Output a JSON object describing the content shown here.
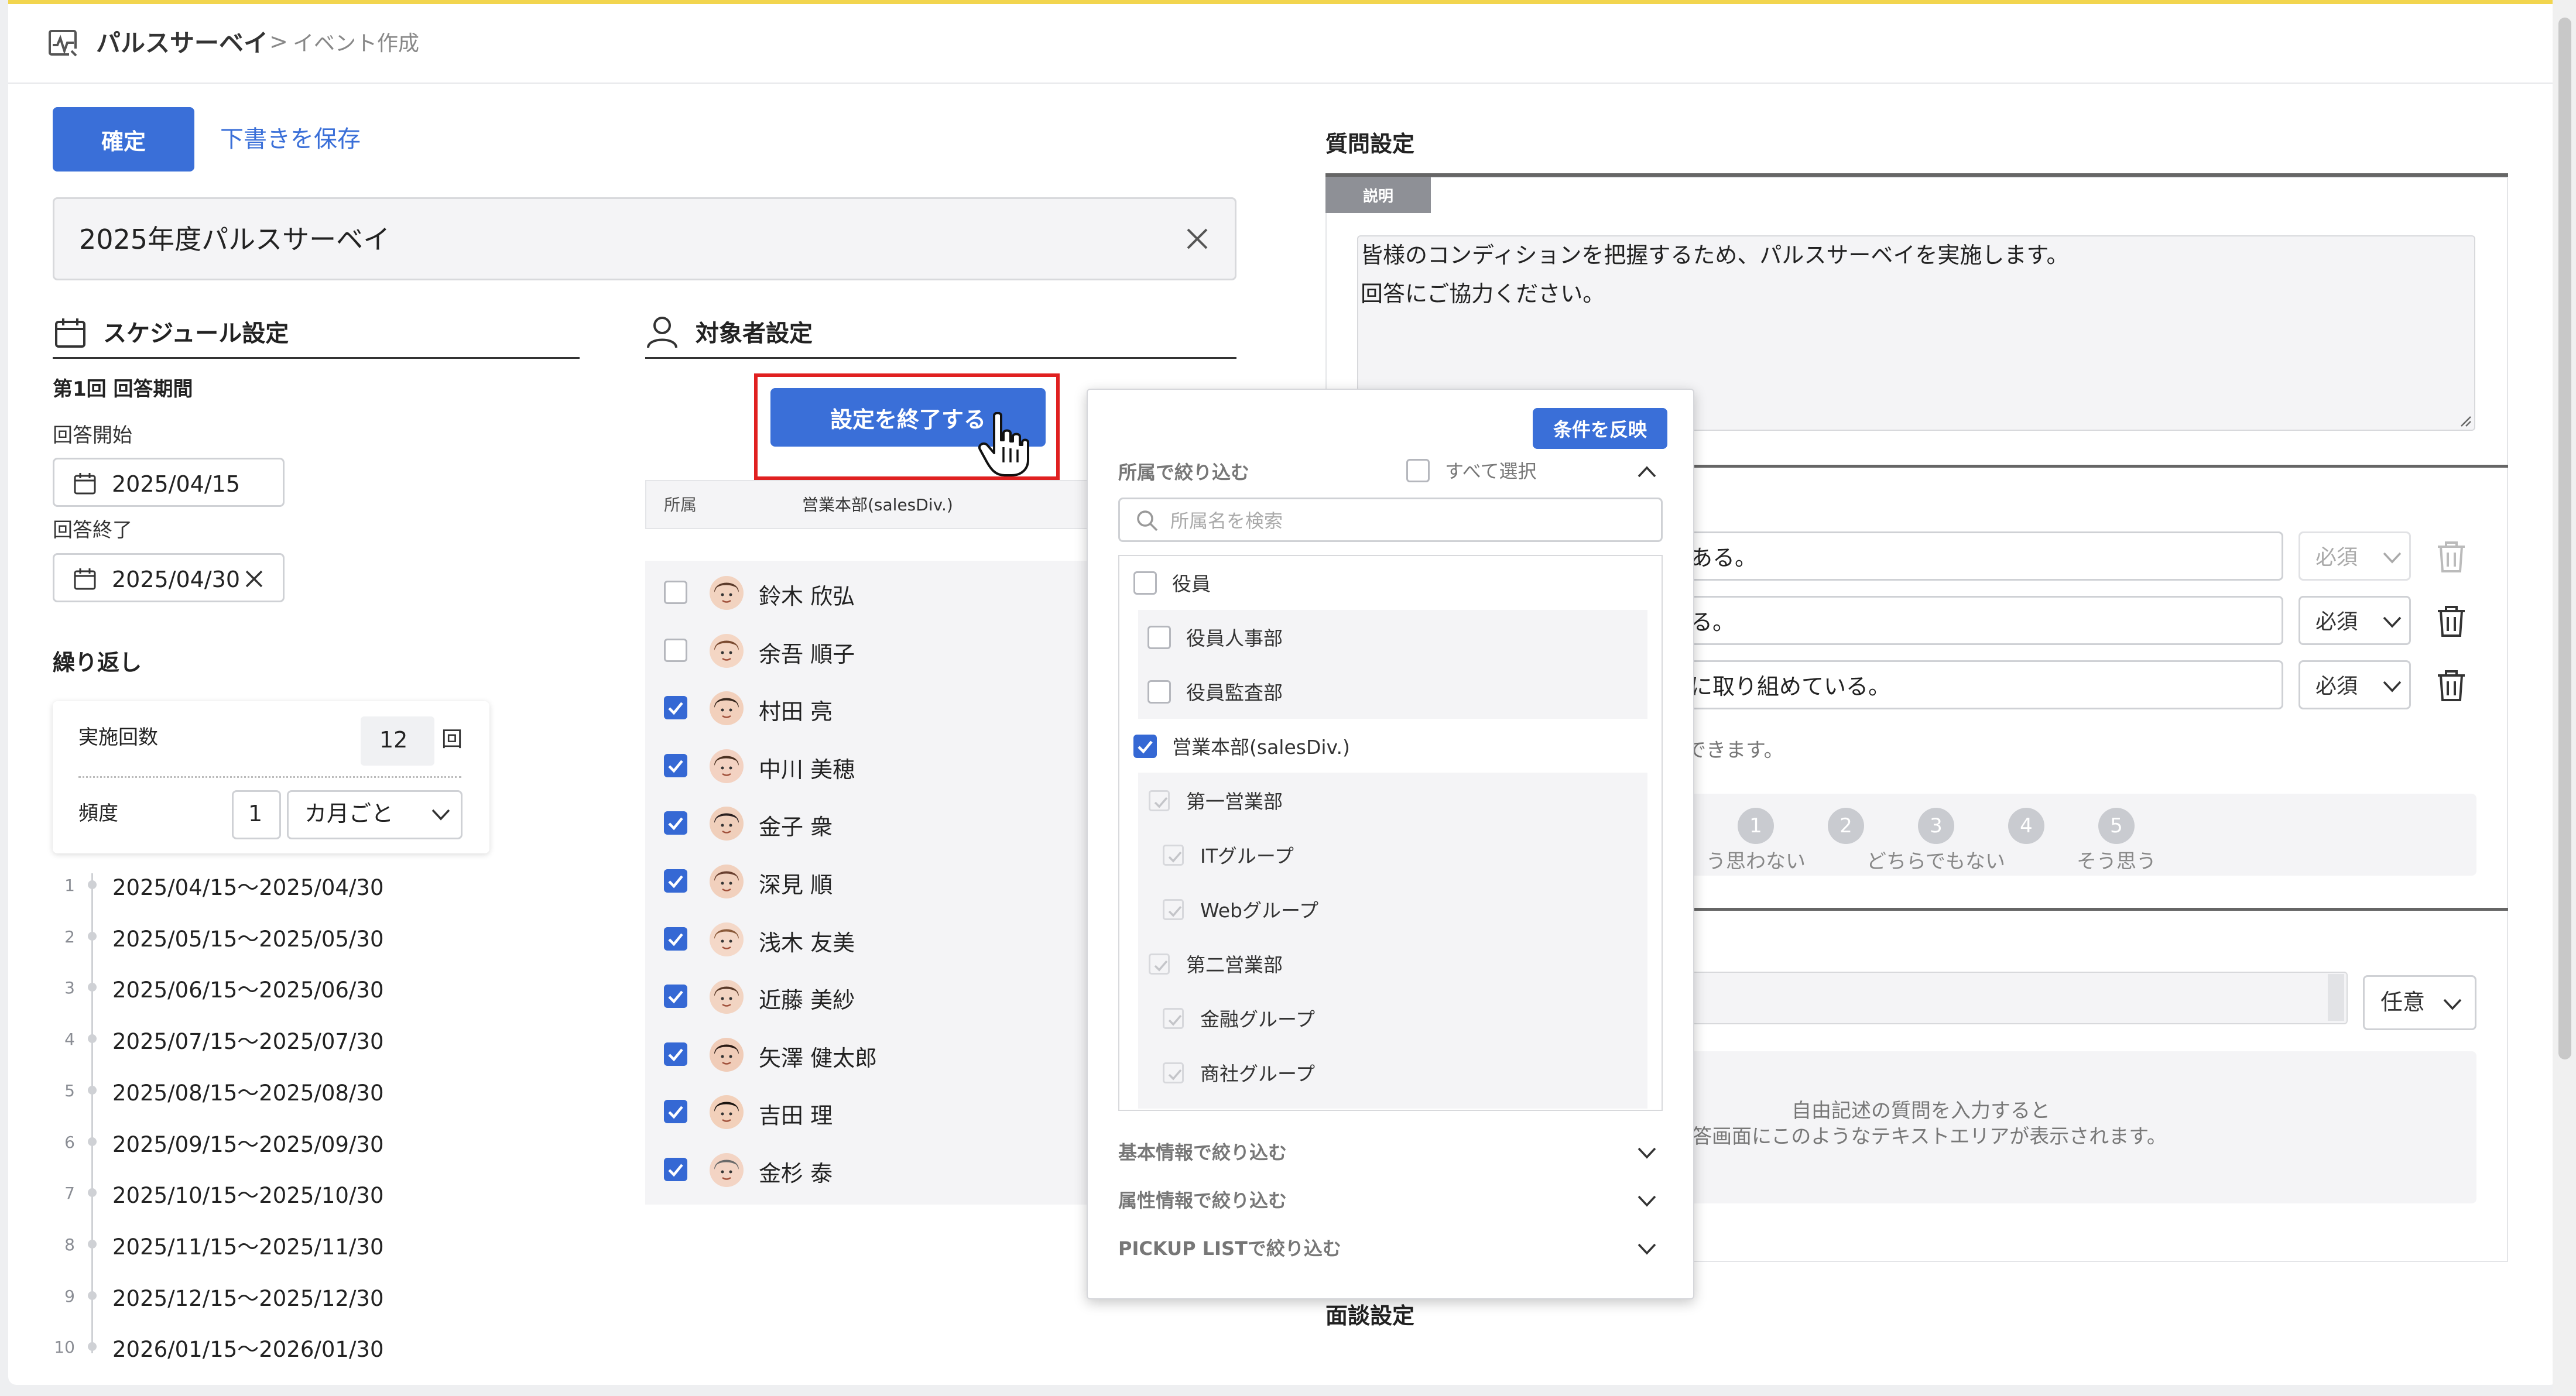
{
  "header": {
    "app_name": "パルスサーベイ",
    "breadcrumb_sep": ">",
    "breadcrumb_current": "イベント作成"
  },
  "toolbar": {
    "confirm_label": "確定",
    "save_draft_label": "下書きを保存"
  },
  "event_title": {
    "value": "2025年度パルスサーベイ"
  },
  "schedule": {
    "section_title": "スケジュール設定",
    "period_heading": "第1回 回答期間",
    "start_label": "回答開始",
    "start_value": "2025/04/15",
    "end_label": "回答終了",
    "end_value": "2025/04/30",
    "repeat_heading": "繰り返し",
    "count_label": "実施回数",
    "count_value": "12",
    "count_unit": "回",
    "frequency_label": "頻度",
    "frequency_value": "1",
    "frequency_unit": "カ月ごと",
    "rows": [
      {
        "n": "1",
        "range": "2025/04/15〜2025/04/30"
      },
      {
        "n": "2",
        "range": "2025/05/15〜2025/05/30"
      },
      {
        "n": "3",
        "range": "2025/06/15〜2025/06/30"
      },
      {
        "n": "4",
        "range": "2025/07/15〜2025/07/30"
      },
      {
        "n": "5",
        "range": "2025/08/15〜2025/08/30"
      },
      {
        "n": "6",
        "range": "2025/09/15〜2025/09/30"
      },
      {
        "n": "7",
        "range": "2025/10/15〜2025/10/30"
      },
      {
        "n": "8",
        "range": "2025/11/15〜2025/11/30"
      },
      {
        "n": "9",
        "range": "2025/12/15〜2025/12/30"
      },
      {
        "n": "10",
        "range": "2026/01/15〜2026/01/30"
      }
    ]
  },
  "target": {
    "section_title": "対象者設定",
    "finish_button": "設定を終了する",
    "col_dept": "所属",
    "col_dept_value": "営業本部(salesDiv.)",
    "people": [
      {
        "name": "鈴木 欣弘",
        "checked": false
      },
      {
        "name": "余吾 順子",
        "checked": false
      },
      {
        "name": "村田 亮",
        "checked": true
      },
      {
        "name": "中川 美穂",
        "checked": true
      },
      {
        "name": "金子 衆",
        "checked": true
      },
      {
        "name": "深見 順",
        "checked": true
      },
      {
        "name": "浅木 友美",
        "checked": true
      },
      {
        "name": "近藤 美紗",
        "checked": true
      },
      {
        "name": "矢澤 健太郎",
        "checked": true
      },
      {
        "name": "吉田 理",
        "checked": true
      },
      {
        "name": "金杉 泰",
        "checked": true
      }
    ]
  },
  "filter_panel": {
    "apply_button": "条件を反映",
    "dept_filter_label": "所属で絞り込む",
    "select_all_label": "すべて選択",
    "search_placeholder": "所属名を検索",
    "depts": [
      {
        "label": "役員",
        "level": 0,
        "state": "unchecked"
      },
      {
        "label": "役員人事部",
        "level": 1,
        "state": "unchecked"
      },
      {
        "label": "役員監査部",
        "level": 1,
        "state": "unchecked"
      },
      {
        "label": "営業本部(salesDiv.)",
        "level": 0,
        "state": "checked"
      },
      {
        "label": "第一営業部",
        "level": 1,
        "state": "disabled"
      },
      {
        "label": "ITグループ",
        "level": 2,
        "state": "disabled"
      },
      {
        "label": "Webグループ",
        "level": 2,
        "state": "disabled"
      },
      {
        "label": "第二営業部",
        "level": 1,
        "state": "disabled"
      },
      {
        "label": "金融グループ",
        "level": 2,
        "state": "disabled"
      },
      {
        "label": "商社グループ",
        "level": 2,
        "state": "disabled"
      }
    ],
    "basic_filter_label": "基本情報で絞り込む",
    "attr_filter_label": "属性情報で絞り込む",
    "pickup_filter_label": "PICKUP LISTで絞り込む"
  },
  "questions": {
    "section_title": "質問設定",
    "description_tab": "説明",
    "description_line1": "皆様のコンディションを把握するため、パルスサーベイを実施します。",
    "description_line2": "回答にご協力ください。",
    "items": [
      {
        "text_fragment": "ある。",
        "required": "必須"
      },
      {
        "text_fragment": "る。",
        "required": "必須"
      },
      {
        "text_fragment": "に取り組めている。",
        "required": "必須"
      }
    ],
    "hint_fragment": "できます。",
    "scale": [
      {
        "n": "1",
        "label": "う思わない"
      },
      {
        "n": "2",
        "label": ""
      },
      {
        "n": "3",
        "label": "どちらでもない"
      },
      {
        "n": "4",
        "label": ""
      },
      {
        "n": "5",
        "label": "そう思う"
      }
    ],
    "free_required": "任意",
    "free_preview_line1": "自由記述の質問を入力すると",
    "free_preview_line2": "答画面にこのようなテキストエリアが表示されます。",
    "interview_title": "面談設定"
  },
  "colors": {
    "accent": "#3a6fd8",
    "highlight_border": "#e02020",
    "top_bar": "#f2d54e"
  }
}
